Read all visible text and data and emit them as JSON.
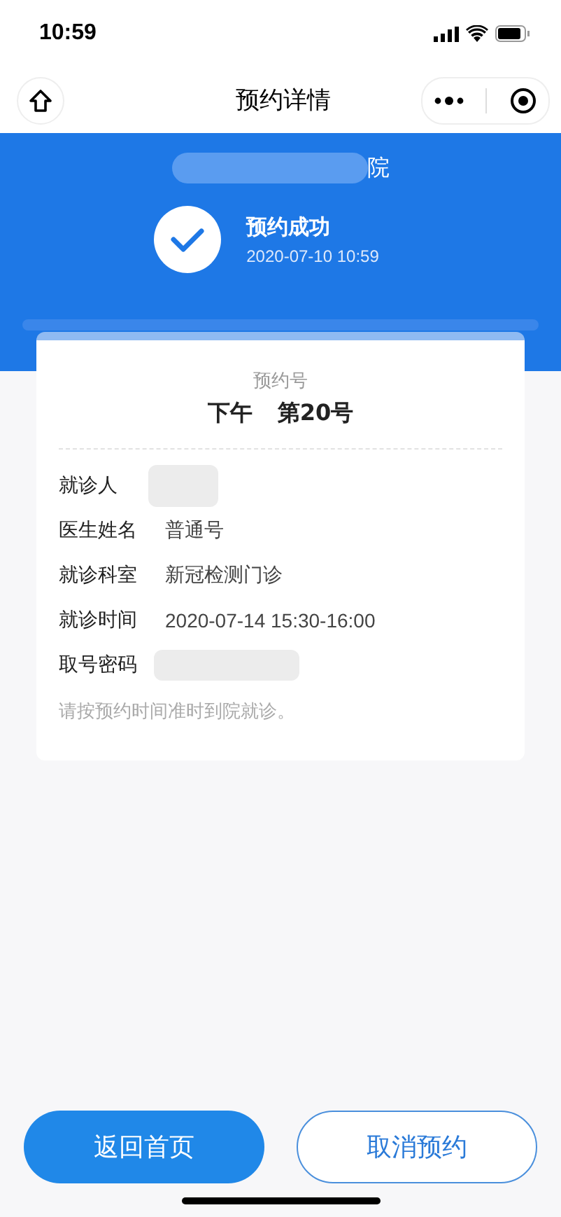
{
  "status_bar": {
    "time": "10:59"
  },
  "nav": {
    "title": "预约详情"
  },
  "header": {
    "hospital": {
      "name": "院",
      "redacted": true
    },
    "status": "预约成功",
    "time": "2020-07-10 10:59"
  },
  "ticket": {
    "label": "预约号",
    "period": "下午",
    "number": "第20号"
  },
  "rows": [
    {
      "label": "就诊人",
      "kind": "redacted"
    },
    {
      "label": "医生姓名",
      "kind": "text",
      "value": "普通号"
    },
    {
      "label": "就诊科室",
      "kind": "text",
      "value": "新冠检测门诊"
    },
    {
      "label": "就诊时间",
      "kind": "text",
      "value": "2020-07-14 15:30-16:00"
    },
    {
      "label": "取号密码",
      "kind": "redacted"
    }
  ],
  "note": "请按预约时间准时到院就诊。",
  "buttons": [
    {
      "label": "返回首页",
      "kind": "primary"
    },
    {
      "label": "取消预约",
      "kind": "outline"
    }
  ]
}
